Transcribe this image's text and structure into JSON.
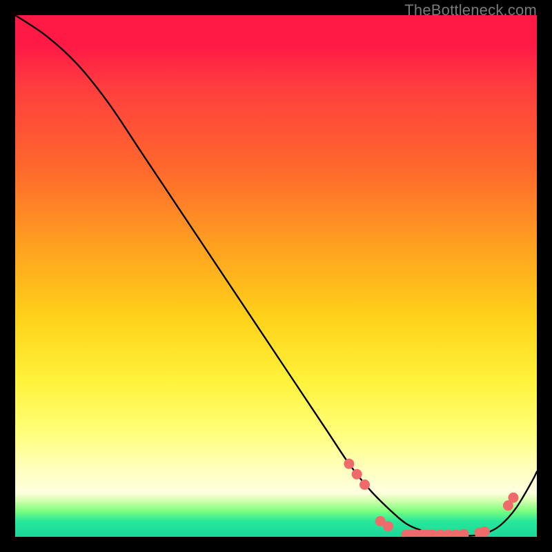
{
  "watermark": "TheBottleneck.com",
  "colors": {
    "curve": "#000000",
    "marker_fill": "#ef6b6b",
    "marker_stroke": "#e35c5c",
    "bg_black": "#000000"
  },
  "chart_data": {
    "type": "line",
    "title": "",
    "xlabel": "",
    "ylabel": "",
    "xlim": [
      0,
      100
    ],
    "ylim": [
      0,
      100
    ],
    "grid": false,
    "series": [
      {
        "name": "curve",
        "x": [
          0,
          6,
          12,
          18,
          24,
          30,
          36,
          42,
          48,
          54,
          60,
          64,
          68,
          72,
          75,
          78,
          81,
          84,
          87,
          90,
          93,
          96,
          99,
          100
        ],
        "y": [
          100,
          96,
          90.5,
          83,
          74,
          65,
          56,
          47,
          38,
          29,
          20,
          14,
          9,
          5,
          2.5,
          1.2,
          0.5,
          0.2,
          0.2,
          0.6,
          2.2,
          5.5,
          10.5,
          12.5
        ]
      }
    ],
    "markers": [
      {
        "x": 64.0,
        "y": 14.0
      },
      {
        "x": 65.5,
        "y": 12.0
      },
      {
        "x": 67.0,
        "y": 10.0
      },
      {
        "x": 70.0,
        "y": 3.0
      },
      {
        "x": 71.5,
        "y": 2.0
      },
      {
        "x": 75.0,
        "y": 0.4
      },
      {
        "x": 76.0,
        "y": 0.4
      },
      {
        "x": 77.0,
        "y": 0.4
      },
      {
        "x": 78.0,
        "y": 0.4
      },
      {
        "x": 79.0,
        "y": 0.4
      },
      {
        "x": 80.0,
        "y": 0.4
      },
      {
        "x": 81.5,
        "y": 0.4
      },
      {
        "x": 83.0,
        "y": 0.4
      },
      {
        "x": 84.5,
        "y": 0.4
      },
      {
        "x": 86.0,
        "y": 0.5
      },
      {
        "x": 89.0,
        "y": 0.8
      },
      {
        "x": 90.0,
        "y": 1.0
      },
      {
        "x": 94.5,
        "y": 6.0
      },
      {
        "x": 95.5,
        "y": 7.5
      }
    ]
  }
}
